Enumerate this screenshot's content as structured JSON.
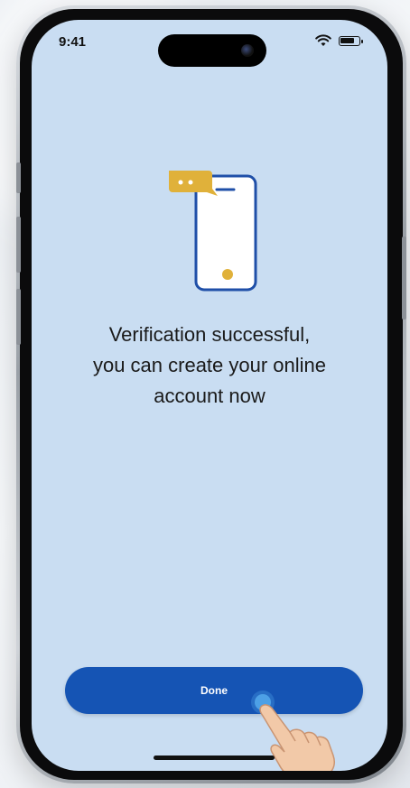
{
  "status_bar": {
    "time": "9:41",
    "icons": [
      "wifi-icon",
      "battery-icon"
    ]
  },
  "illustration": {
    "icon": "phone-chat-icon",
    "colors": {
      "outline": "#1f4fa8",
      "accent": "#e0b13a",
      "fill": "#ffffff"
    }
  },
  "message": {
    "lines": [
      "Verification successful,",
      "you can create your online",
      "account now"
    ]
  },
  "done_button": {
    "label": "Done",
    "color": "#1554b4"
  },
  "screen": {
    "background": "#c9ddf2"
  }
}
